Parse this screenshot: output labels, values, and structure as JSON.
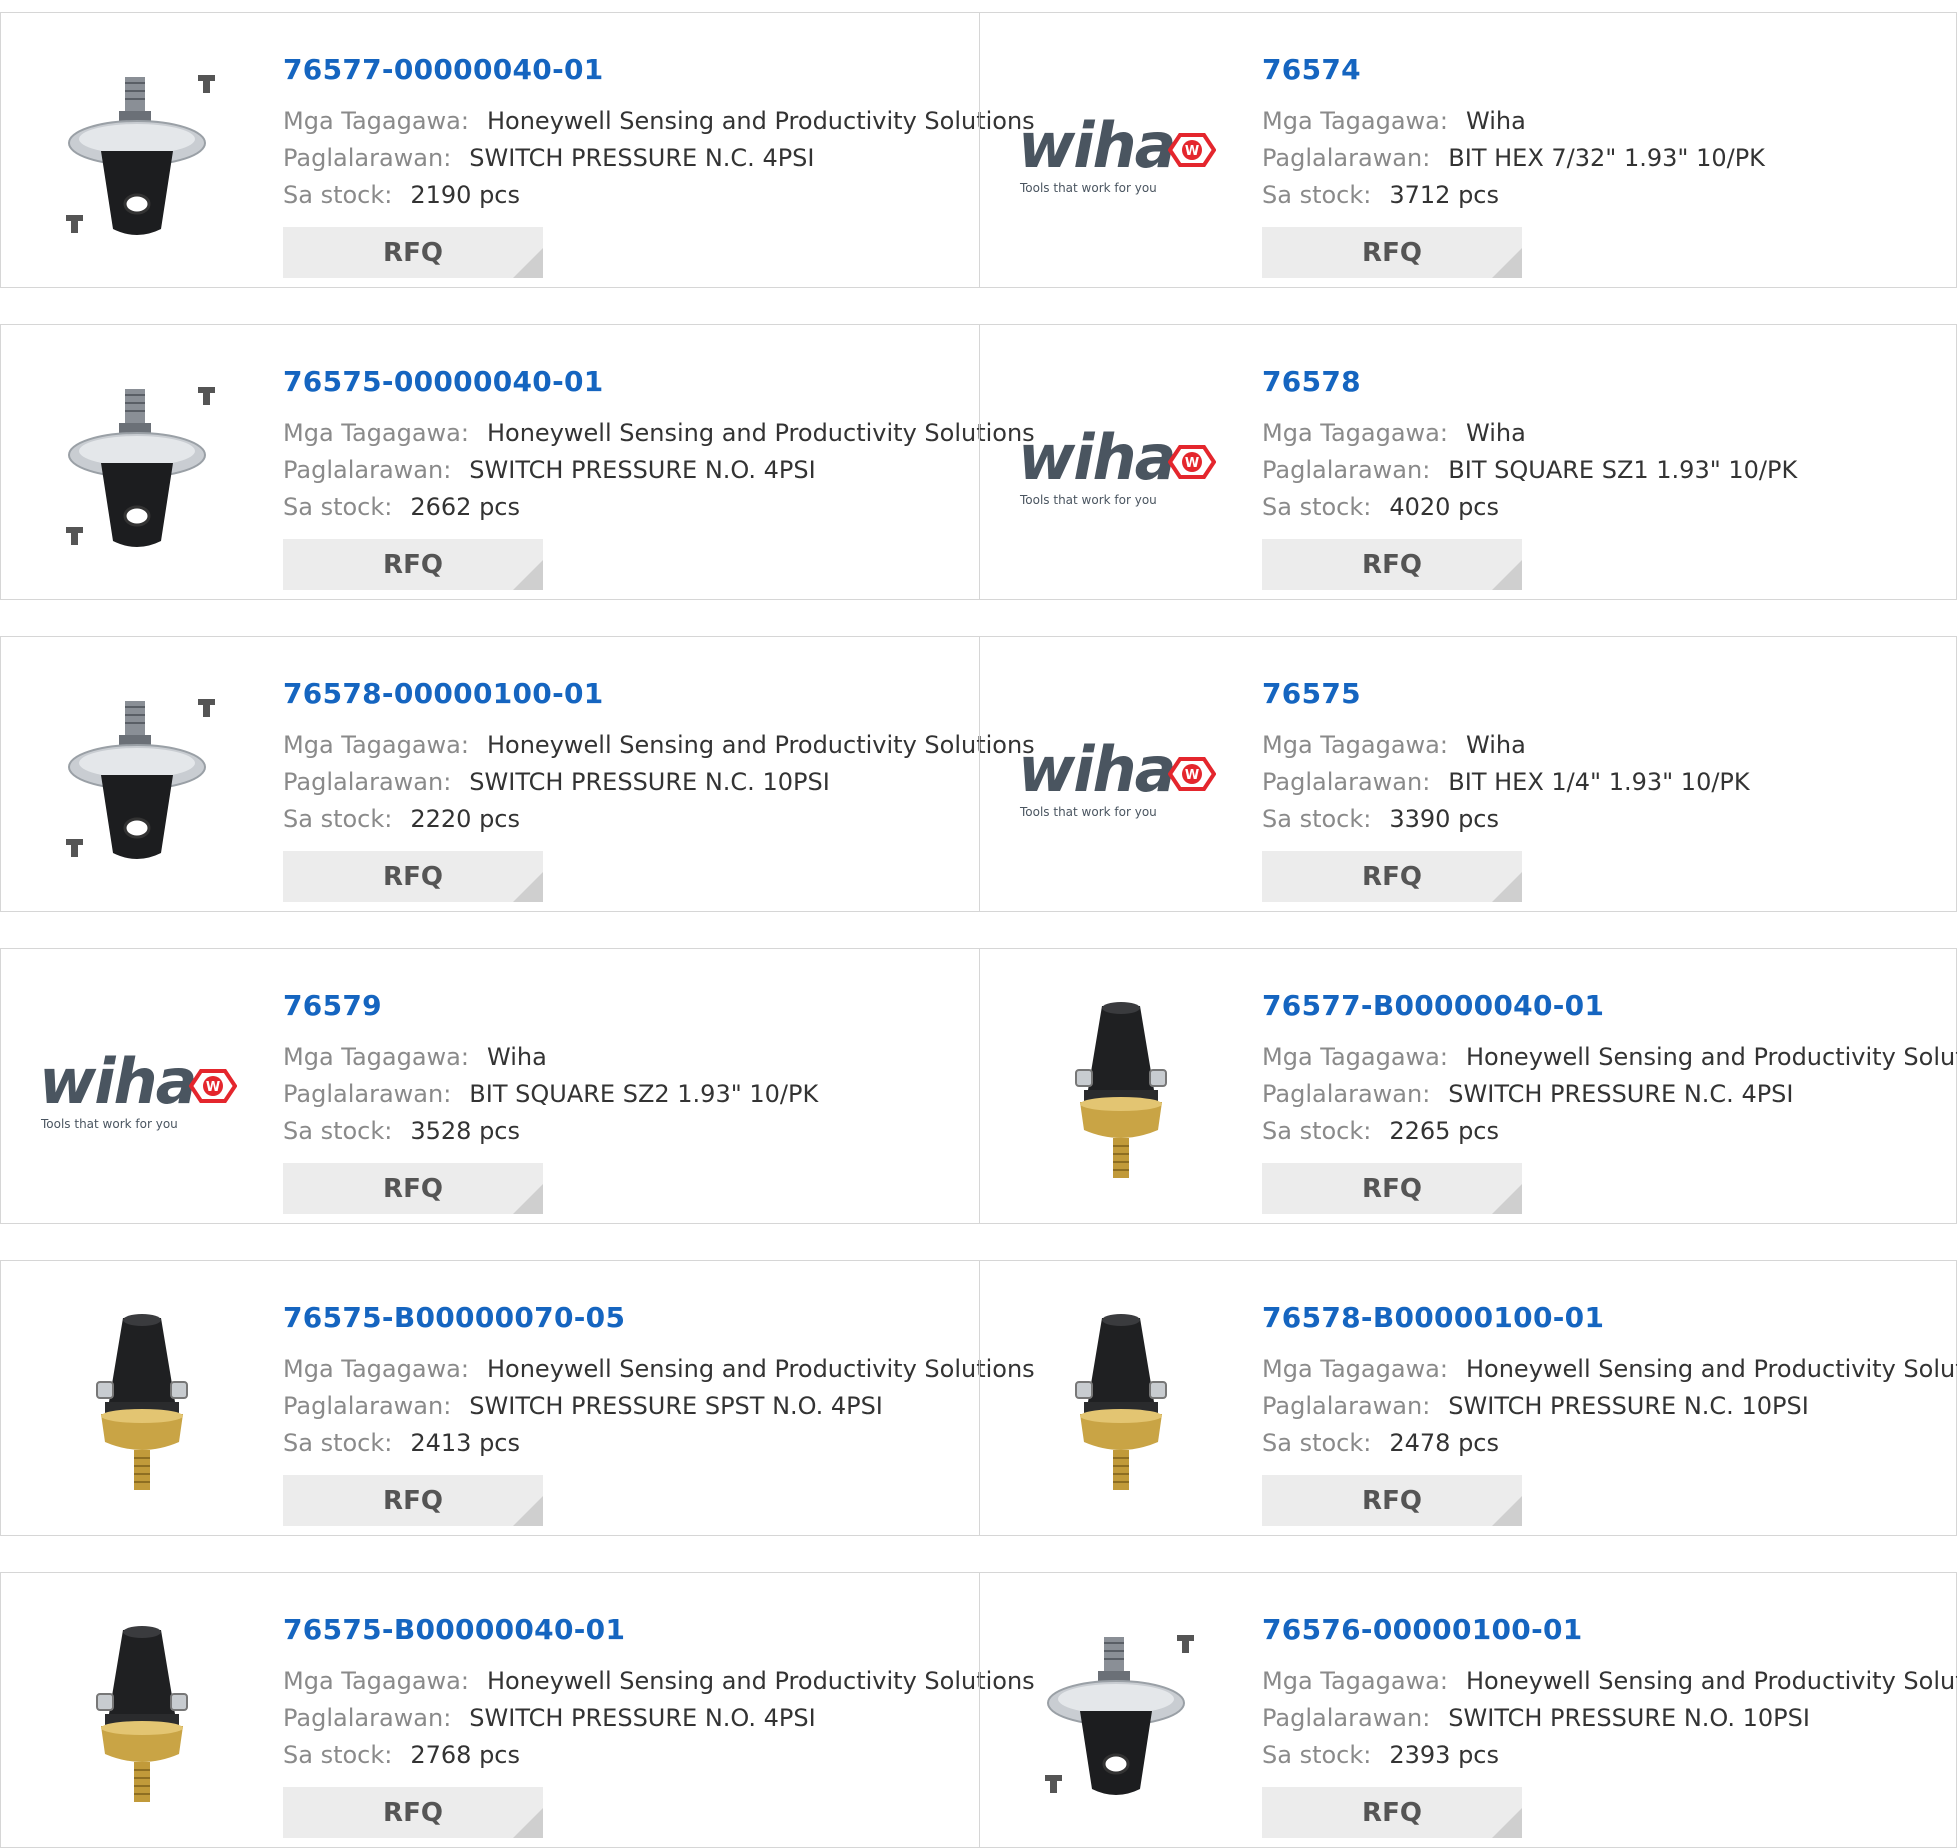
{
  "labels": {
    "manufacturer": "Mga Tagagawa:",
    "description": "Paglalarawan:",
    "stock": "Sa stock:",
    "rfq": "RFQ"
  },
  "brand_logo": {
    "word": "wiha",
    "tagline": "Tools that work for you",
    "badge_letter": "W",
    "colors": {
      "word": "#4a5560",
      "badge": "#e4262d"
    }
  },
  "accent_color": "#1565c0",
  "products": [
    {
      "part_number": "76577-00000040-01",
      "manufacturer": "Honeywell Sensing and Productivity Solutions",
      "description": "SWITCH PRESSURE N.C. 4PSI",
      "stock": "2190 pcs",
      "image": "pressure-switch-black-icon"
    },
    {
      "part_number": "76574",
      "manufacturer": "Wiha",
      "description": "BIT HEX 7/32\" 1.93\" 10/PK",
      "stock": "3712 pcs",
      "image": "wiha-logo"
    },
    {
      "part_number": "76575-00000040-01",
      "manufacturer": "Honeywell Sensing and Productivity Solutions",
      "description": "SWITCH PRESSURE N.O. 4PSI",
      "stock": "2662 pcs",
      "image": "pressure-switch-black-icon"
    },
    {
      "part_number": "76578",
      "manufacturer": "Wiha",
      "description": "BIT SQUARE SZ1 1.93\" 10/PK",
      "stock": "4020 pcs",
      "image": "wiha-logo"
    },
    {
      "part_number": "76578-00000100-01",
      "manufacturer": "Honeywell Sensing and Productivity Solutions",
      "description": "SWITCH PRESSURE N.C. 10PSI",
      "stock": "2220 pcs",
      "image": "pressure-switch-black-icon"
    },
    {
      "part_number": "76575",
      "manufacturer": "Wiha",
      "description": "BIT HEX 1/4\" 1.93\" 10/PK",
      "stock": "3390 pcs",
      "image": "wiha-logo"
    },
    {
      "part_number": "76579",
      "manufacturer": "Wiha",
      "description": "BIT SQUARE SZ2 1.93\" 10/PK",
      "stock": "3528 pcs",
      "image": "wiha-logo"
    },
    {
      "part_number": "76577-B00000040-01",
      "manufacturer": "Honeywell Sensing and Productivity Solutions",
      "description": "SWITCH PRESSURE N.C. 4PSI",
      "stock": "2265 pcs",
      "image": "pressure-switch-brass-icon"
    },
    {
      "part_number": "76575-B00000070-05",
      "manufacturer": "Honeywell Sensing and Productivity Solutions",
      "description": "SWITCH PRESSURE SPST N.O. 4PSI",
      "stock": "2413 pcs",
      "image": "pressure-switch-brass-icon"
    },
    {
      "part_number": "76578-B00000100-01",
      "manufacturer": "Honeywell Sensing and Productivity Solutions",
      "description": "SWITCH PRESSURE N.C. 10PSI",
      "stock": "2478 pcs",
      "image": "pressure-switch-brass-icon"
    },
    {
      "part_number": "76575-B00000040-01",
      "manufacturer": "Honeywell Sensing and Productivity Solutions",
      "description": "SWITCH PRESSURE N.O. 4PSI",
      "stock": "2768 pcs",
      "image": "pressure-switch-brass-icon"
    },
    {
      "part_number": "76576-00000100-01",
      "manufacturer": "Honeywell Sensing and Productivity Solutions",
      "description": "SWITCH PRESSURE N.O. 10PSI",
      "stock": "2393 pcs",
      "image": "pressure-switch-black-icon"
    }
  ]
}
